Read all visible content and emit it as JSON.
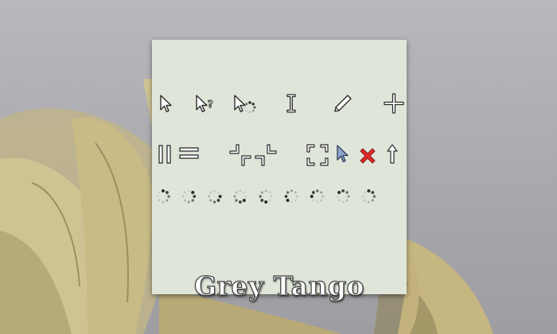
{
  "theme": {
    "name": "Grey Tango",
    "colors": {
      "panel": "#dfe6d9",
      "cursor_stroke": "#2c2c2c",
      "cursor_fill": "#ffffff",
      "hand_pointer": "#8ea6cf",
      "forbidden": "#e02b2b",
      "spinner_dot": "#3a3a3a"
    }
  },
  "cursors": [
    {
      "row": 1,
      "icon": "left-arrow-cursor-icon"
    },
    {
      "row": 1,
      "icon": "help-arrow-cursor-icon"
    },
    {
      "row": 1,
      "icon": "progress-arrow-cursor-icon"
    },
    {
      "row": 1,
      "icon": "text-ibeam-cursor-icon"
    },
    {
      "row": 1,
      "icon": "pencil-cursor-icon"
    },
    {
      "row": 1,
      "icon": "crosshair-cursor-icon"
    },
    {
      "row": 2,
      "icon": "column-resize-cursor-icon"
    },
    {
      "row": 2,
      "icon": "row-resize-cursor-icon"
    },
    {
      "row": 2,
      "icon": "corner-resize-cursor-icon"
    },
    {
      "row": 2,
      "icon": "corner-resize-alt-cursor-icon"
    },
    {
      "row": 2,
      "icon": "fullscreen-cursor-icon"
    },
    {
      "row": 2,
      "icon": "blue-pointer-cursor-icon"
    },
    {
      "row": 2,
      "icon": "forbidden-x-cursor-icon"
    },
    {
      "row": 2,
      "icon": "up-arrow-cursor-icon"
    },
    {
      "row": 3,
      "icon": "busy-spinner-cursor-icon",
      "frames": 9
    }
  ]
}
